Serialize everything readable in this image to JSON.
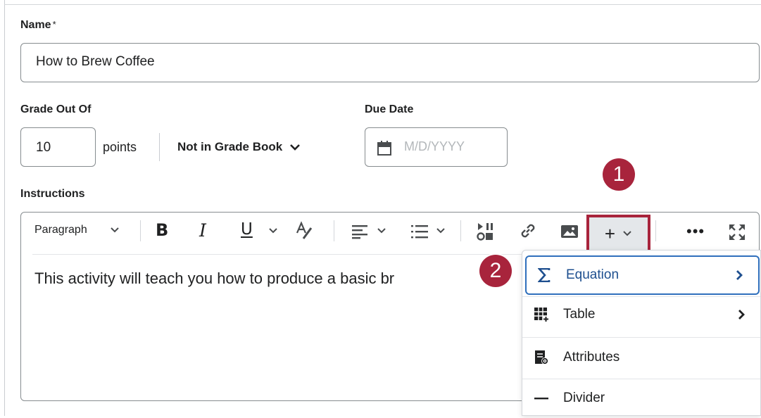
{
  "form": {
    "name_label": "Name",
    "name_required_mark": "*",
    "name_value": "How to Brew Coffee",
    "grade_label": "Grade Out Of",
    "grade_value": "10",
    "grade_unit": "points",
    "gradebook_option": "Not in Grade Book",
    "due_label": "Due Date",
    "due_placeholder": "M/D/YYYY",
    "instructions_label": "Instructions"
  },
  "toolbar": {
    "paragraph_label": "Paragraph",
    "bold": "B",
    "italic": "I",
    "underline": "U",
    "insert_label": "+",
    "more_label": "•••"
  },
  "editor": {
    "content": "This activity will teach you how to produce a basic br"
  },
  "callouts": [
    "1",
    "2"
  ],
  "insert_menu": {
    "items": [
      {
        "label": "Equation",
        "icon": "sigma-icon",
        "submenu": true,
        "active": true
      },
      {
        "label": "Table",
        "icon": "table-icon",
        "submenu": true,
        "active": false
      },
      {
        "label": "Attributes",
        "icon": "attributes-icon",
        "submenu": false,
        "active": false
      },
      {
        "label": "Divider",
        "icon": "divider-icon",
        "submenu": false,
        "active": false
      }
    ]
  },
  "colors": {
    "callout": "#a8243c",
    "focus_border": "#2f6fbc",
    "active_text": "#1e4f8f"
  }
}
